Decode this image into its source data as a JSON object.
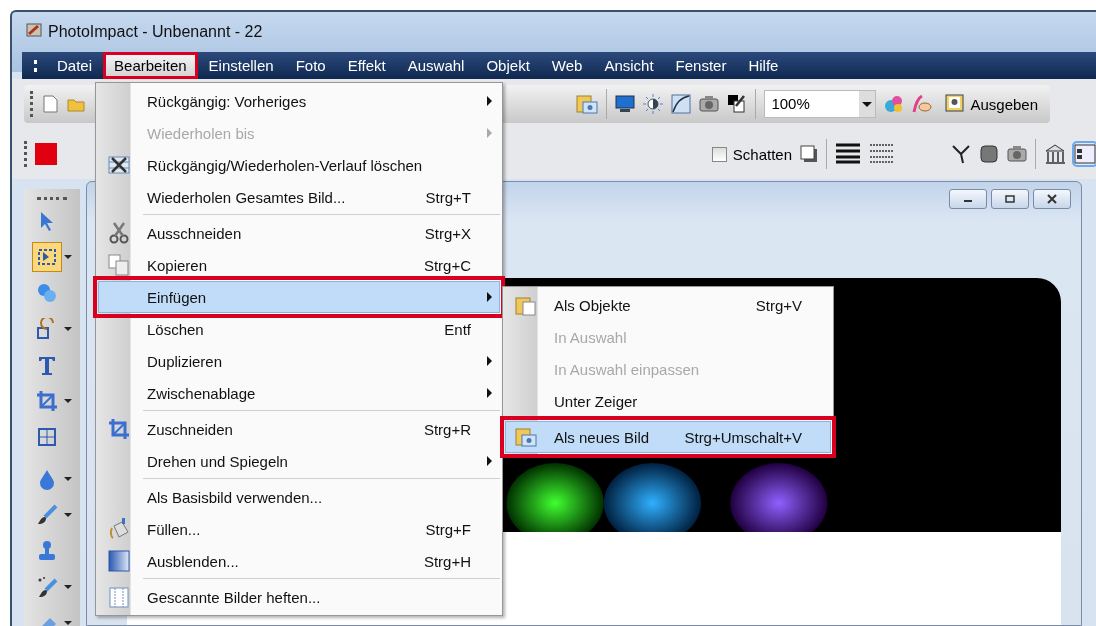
{
  "window": {
    "title": "PhotoImpact - Unbenannt - 22"
  },
  "menubar": [
    {
      "label": "Datei",
      "selected": false,
      "annotated": false
    },
    {
      "label": "Bearbeiten",
      "selected": true,
      "annotated": true
    },
    {
      "label": "Einstellen",
      "selected": false,
      "annotated": false
    },
    {
      "label": "Foto",
      "selected": false,
      "annotated": false
    },
    {
      "label": "Effekt",
      "selected": false,
      "annotated": false
    },
    {
      "label": "Auswahl",
      "selected": false,
      "annotated": false
    },
    {
      "label": "Objekt",
      "selected": false,
      "annotated": false
    },
    {
      "label": "Web",
      "selected": false,
      "annotated": false
    },
    {
      "label": "Ansicht",
      "selected": false,
      "annotated": false
    },
    {
      "label": "Fenster",
      "selected": false,
      "annotated": false
    },
    {
      "label": "Hilfe",
      "selected": false,
      "annotated": false
    }
  ],
  "toolbar": {
    "zoom": {
      "value": "100%"
    },
    "output_button": "Ausgeben"
  },
  "attribute_bar": {
    "shadow": {
      "label": "Schatten",
      "checked": false
    }
  },
  "tools": [
    {
      "selected": false
    },
    {
      "selected": true
    },
    {
      "selected": false
    },
    {
      "selected": false
    },
    {
      "selected": false
    },
    {
      "selected": false
    },
    {
      "selected": false
    },
    {
      "selected": false
    },
    {
      "selected": false
    },
    {
      "selected": false
    },
    {
      "selected": false
    },
    {
      "selected": false
    }
  ],
  "edit_menu": {
    "items": [
      {
        "kind": "item",
        "label": "Rückgängig: Vorheriges",
        "submenu": true,
        "disabled": false,
        "selected": false,
        "annotated": false
      },
      {
        "kind": "item",
        "label": "Wiederholen bis",
        "submenu": true,
        "disabled": true,
        "selected": false,
        "annotated": false
      },
      {
        "kind": "item",
        "label": "Rückgängig/Wiederholen-Verlauf löschen",
        "submenu": false,
        "disabled": false,
        "selected": false,
        "annotated": false
      },
      {
        "kind": "item",
        "label": "Wiederholen Gesamtes Bild...",
        "shortcut": "Strg+T",
        "submenu": false,
        "disabled": false,
        "selected": false,
        "annotated": false
      },
      {
        "kind": "separator"
      },
      {
        "kind": "item",
        "label": "Ausschneiden",
        "shortcut": "Strg+X",
        "submenu": false,
        "disabled": false,
        "selected": false,
        "annotated": false
      },
      {
        "kind": "item",
        "label": "Kopieren",
        "shortcut": "Strg+C",
        "submenu": false,
        "disabled": false,
        "selected": false,
        "annotated": false
      },
      {
        "kind": "item",
        "label": "Einfügen",
        "submenu": true,
        "disabled": false,
        "selected": true,
        "annotated": true
      },
      {
        "kind": "item",
        "label": "Löschen",
        "shortcut": "Entf",
        "submenu": false,
        "disabled": false,
        "selected": false,
        "annotated": false
      },
      {
        "kind": "item",
        "label": "Duplizieren",
        "submenu": true,
        "disabled": false,
        "selected": false,
        "annotated": false
      },
      {
        "kind": "item",
        "label": "Zwischenablage",
        "submenu": true,
        "disabled": false,
        "selected": false,
        "annotated": false
      },
      {
        "kind": "separator"
      },
      {
        "kind": "item",
        "label": "Zuschneiden",
        "shortcut": "Strg+R",
        "submenu": false,
        "disabled": false,
        "selected": false,
        "annotated": false
      },
      {
        "kind": "item",
        "label": "Drehen und Spiegeln",
        "submenu": true,
        "disabled": false,
        "selected": false,
        "annotated": false
      },
      {
        "kind": "separator"
      },
      {
        "kind": "item",
        "label": "Als Basisbild verwenden...",
        "submenu": false,
        "disabled": false,
        "selected": false,
        "annotated": false
      },
      {
        "kind": "item",
        "label": "Füllen...",
        "shortcut": "Strg+F",
        "submenu": false,
        "disabled": false,
        "selected": false,
        "annotated": false
      },
      {
        "kind": "item",
        "label": "Ausblenden...",
        "shortcut": "Strg+H",
        "submenu": false,
        "disabled": false,
        "selected": false,
        "annotated": false
      },
      {
        "kind": "separator"
      },
      {
        "kind": "item",
        "label": "Gescannte Bilder heften...",
        "submenu": false,
        "disabled": false,
        "selected": false,
        "annotated": false
      }
    ]
  },
  "paste_submenu": {
    "items": [
      {
        "kind": "item",
        "label": "Als Objekte",
        "shortcut": "Strg+V",
        "submenu": false,
        "disabled": false,
        "selected": false,
        "annotated": false
      },
      {
        "kind": "item",
        "label": "In Auswahl",
        "submenu": false,
        "disabled": true,
        "selected": false,
        "annotated": false
      },
      {
        "kind": "item",
        "label": "In Auswahl einpassen",
        "submenu": false,
        "disabled": true,
        "selected": false,
        "annotated": false
      },
      {
        "kind": "item",
        "label": "Unter Zeiger",
        "submenu": false,
        "disabled": false,
        "selected": false,
        "annotated": false
      },
      {
        "kind": "separator"
      },
      {
        "kind": "item",
        "label": "Als neues Bild",
        "shortcut": "Strg+Umschalt+V",
        "submenu": false,
        "disabled": false,
        "selected": true,
        "annotated": true
      }
    ]
  }
}
